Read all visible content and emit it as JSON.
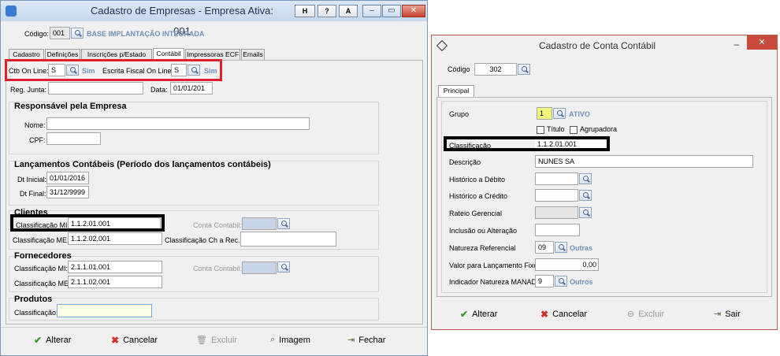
{
  "left": {
    "title": "Cadastro de Empresas - Empresa Ativa: 001",
    "tb_buttons": [
      "H",
      "?",
      "A"
    ],
    "codigo_label": "Código:",
    "codigo_value": "001",
    "company_name": "BASE IMPLANTAÇÃO INTEGRADA",
    "tabs": [
      "Cadastro",
      "Definições",
      "Inscrições p/Estado",
      "Contábil",
      "Impressoras ECF",
      "Emails"
    ],
    "ctb_online_label": "Ctb On Line:",
    "ctb_online_value": "S",
    "ctb_online_sim": "Sim",
    "escrita_label": "Escrita Fiscal On Line:",
    "escrita_value": "S",
    "escrita_sim": "Sim",
    "reg_junta_label": "Reg. Junta:",
    "data_label": "Data:",
    "data_value": "01/01/201",
    "resp_header": "Responsável pela Empresa",
    "nome_label": "Nome:",
    "cpf_label": "CPF:",
    "lanc_header": "Lançamentos Contábeis (Período dos lançamentos contábeis)",
    "dt_inicial_label": "Dt Inicial:",
    "dt_inicial_value": "01/01/2016",
    "dt_final_label": "Dt Final:",
    "dt_final_value": "31/12/9999",
    "clientes_header": "Clientes",
    "cli_mi_label": "Classificação MI:",
    "cli_mi_value": "1.1.2.01.001",
    "cli_me_label": "Classificação ME:",
    "cli_me_value": "1.1.2.02.001",
    "cli_conta_label": "Conta Contabil:",
    "cli_ch_label": "Classificação Ch a Rec.:",
    "forn_header": "Fornecedores",
    "forn_mi_label": "Classificação MI:",
    "forn_mi_value": "2.1.1.01.001",
    "forn_me_label": "Classificação ME:",
    "forn_me_value": "2.1.1.02.001",
    "forn_conta_label": "Conta Contabil:",
    "prod_header": "Produtos",
    "prod_label": "Classificação:",
    "buttons": {
      "alterar": "Alterar",
      "cancelar": "Cancelar",
      "excluir": "Excluir",
      "imagem": "Imagem",
      "fechar": "Fechar"
    }
  },
  "right": {
    "title": "Cadastro de Conta Contábil",
    "codigo_label": "Código",
    "codigo_value": "302",
    "tab": "Principal",
    "grupo_label": "Grupo",
    "grupo_value": "1",
    "grupo_text": "ATIVO",
    "titulo_label": "Título",
    "agrupadora_label": "Agrupadora",
    "class_label": "Classificação",
    "class_value": "1.1.2.01.001",
    "desc_label": "Descrição",
    "desc_value": "NUNES SA",
    "hist_deb_label": "Histórico a Débito",
    "hist_cred_label": "Histórico a Crédito",
    "rateio_label": "Rateio Gerencial",
    "inclusao_label": "Inclusão ou Alteração",
    "natureza_label": "Natureza Referencial",
    "natureza_value": "09",
    "natureza_text": "Outras",
    "valor_label": "Valor para Lançamento Fixo",
    "valor_value": "0,00",
    "ind_label": "Indicador Natureza MANAD",
    "ind_value": "9",
    "ind_text": "Outros",
    "buttons": {
      "alterar": "Alterar",
      "cancelar": "Cancelar",
      "excluir": "Excluir",
      "sair": "Sair"
    }
  },
  "colors": {
    "accent_red": "#e0202a",
    "label_blue": "#7090b8",
    "highlight_yellow": "#f4f47a"
  }
}
